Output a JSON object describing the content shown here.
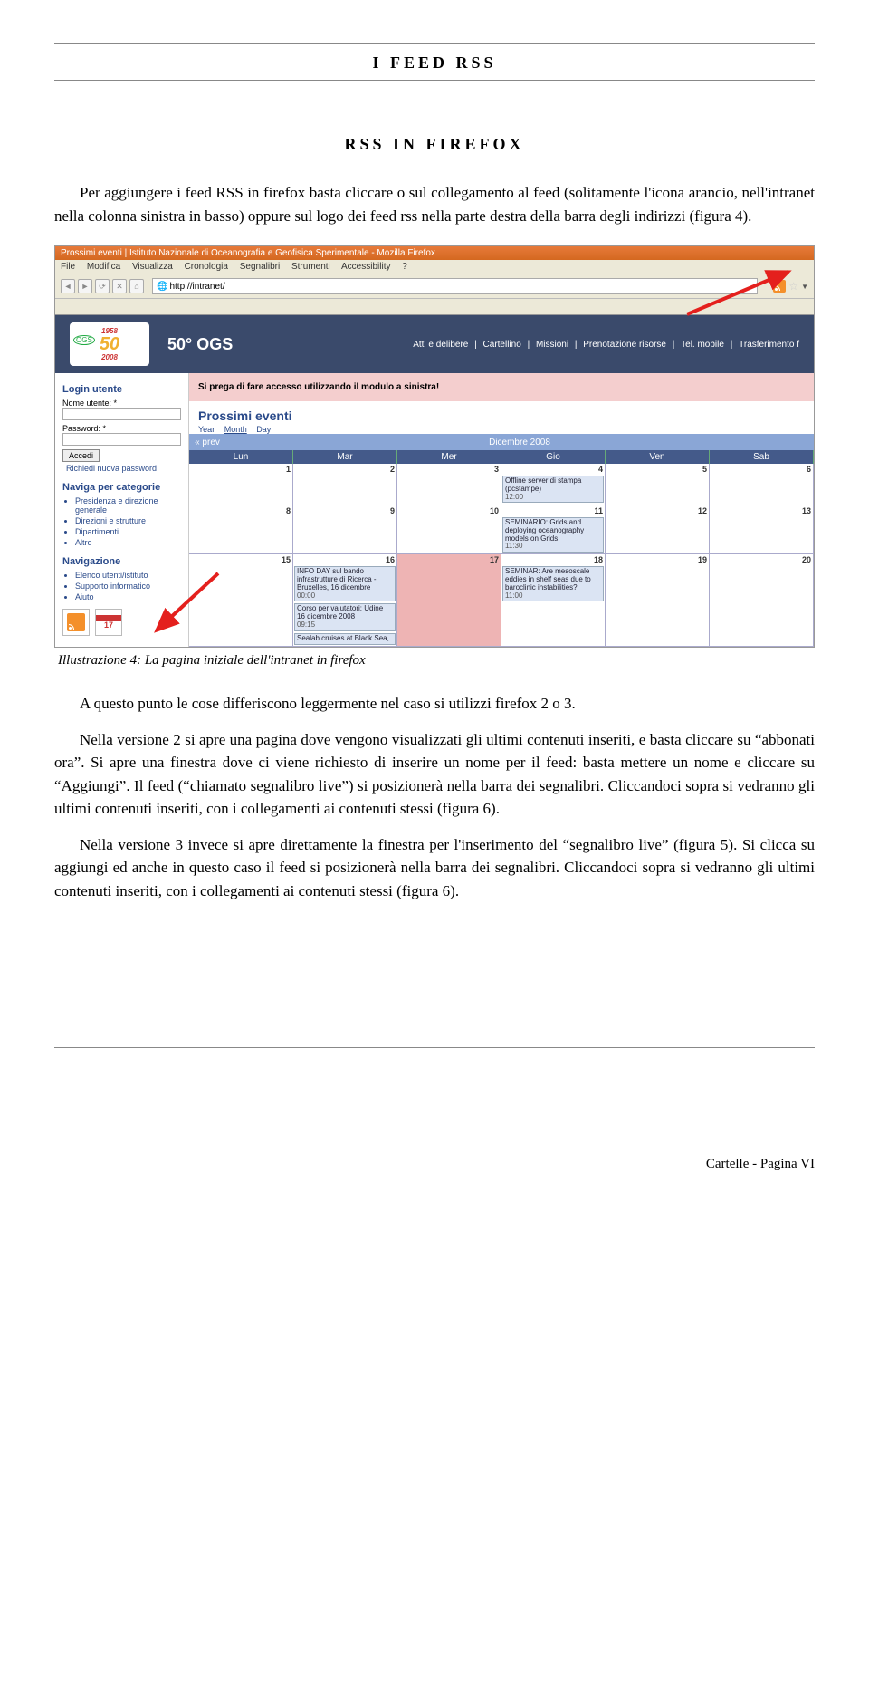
{
  "header": {
    "title": "I FEED RSS"
  },
  "section": {
    "title": "RSS IN FIREFOX"
  },
  "paragraphs": {
    "p1": "Per aggiungere i feed RSS in firefox basta cliccare o sul collegamento al feed (solitamente l'icona arancio, nell'intranet nella colonna sinistra in basso) oppure sul logo dei feed rss nella parte destra della barra degli indirizzi (figura 4).",
    "caption": "Illustrazione 4: La pagina iniziale dell'intranet in firefox",
    "p2": "A questo punto le cose differiscono leggermente nel caso si utilizzi firefox 2 o 3.",
    "p3": "Nella versione 2 si apre una pagina dove vengono visualizzati gli ultimi contenuti inseriti, e basta cliccare su “abbonati ora”. Si apre una finestra dove ci viene richiesto di inserire un nome per il feed: basta mettere un nome e cliccare su “Aggiungi”. Il feed (“chiamato segnalibro live”) si posizionerà nella barra dei segnalibri. Cliccandoci sopra si vedranno gli ultimi contenuti inseriti, con i collegamenti ai contenuti stessi (figura 6).",
    "p4": "Nella versione 3 invece si apre direttamente la finestra per l'inserimento del “segnalibro live” (figura 5). Si clicca su aggiungi ed anche in questo caso il feed si posizionerà nella barra dei segnalibri. Cliccandoci sopra si vedranno gli ultimi contenuti inseriti, con i collegamenti ai contenuti stessi (figura 6)."
  },
  "firefox": {
    "window_title": "Prossimi eventi | Istituto Nazionale di Oceanografia e Geofisica Sperimentale - Mozilla Firefox",
    "menu": [
      "File",
      "Modifica",
      "Visualizza",
      "Cronologia",
      "Segnalibri",
      "Strumenti",
      "Accessibility",
      "?"
    ],
    "url": "http://intranet/",
    "rss_tooltip": "RSS"
  },
  "ogs": {
    "title": "50° OGS",
    "logo_top": "1958",
    "logo_mid": "50",
    "logo_ogs": "OGS",
    "logo_bot": "2008",
    "nav": [
      "Atti e delibere",
      "|",
      "Cartellino",
      "|",
      "Missioni",
      "|",
      "Prenotazione risorse",
      "|",
      "Tel. mobile",
      "|",
      "Trasferimento f"
    ],
    "sidebar": {
      "login_h": "Login utente",
      "user_lbl": "Nome utente: *",
      "pass_lbl": "Password: *",
      "login_btn": "Accedi",
      "forgot": "Richiedi nuova password",
      "cat_h": "Naviga per categorie",
      "cats": [
        "Presidenza e direzione generale",
        "Direzioni e strutture",
        "Dipartimenti",
        "Altro"
      ],
      "nav_h": "Navigazione",
      "navs": [
        "Elenco utenti/istituto",
        "Supporto informatico",
        "Aiuto"
      ],
      "cal_day": "17"
    },
    "warn": "Si prega di fare accesso utilizzando il modulo a sinistra!",
    "events_h": "Prossimi eventi",
    "tabs": {
      "year": "Year",
      "month": "Month",
      "day": "Day"
    },
    "cal": {
      "prev": "« prev",
      "month": "Dicembre 2008",
      "days": [
        "Lun",
        "Mar",
        "Mer",
        "Gio",
        "Ven",
        "Sab"
      ],
      "cells": {
        "r1": [
          "1",
          "2",
          "3",
          "4",
          "5",
          "6"
        ],
        "r2": [
          "8",
          "9",
          "10",
          "11",
          "12",
          "13"
        ],
        "r3": [
          "15",
          "16",
          "17",
          "18",
          "19",
          "20"
        ]
      },
      "ev4": {
        "t": "Offline server di stampa (pcstampe)",
        "time": "12:00"
      },
      "ev11": {
        "t": "SEMINARIO: Grids and deploying oceanography models on Grids",
        "time": "11:30"
      },
      "ev16a": {
        "t": "INFO DAY sul bando infrastrutture di Ricerca - Bruxelles, 16 dicembre",
        "time": "00:00"
      },
      "ev16b": {
        "t": "Corso per valutatori: Udine 16 dicembre 2008",
        "time": "09:15"
      },
      "ev16c": {
        "t": "Sealab cruises at Black Sea,",
        "time": ""
      },
      "ev18": {
        "t": "SEMINAR: Are mesoscale eddies in shelf seas due to baroclinic instabilities?",
        "time": "11:00"
      }
    }
  },
  "footer": "Cartelle - Pagina VI"
}
